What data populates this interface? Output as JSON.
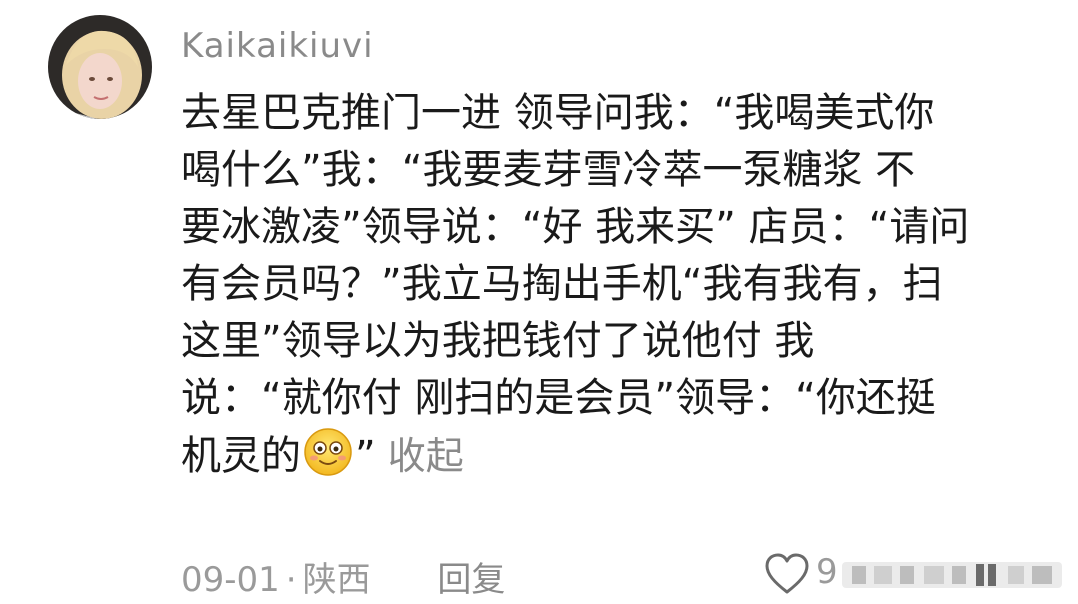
{
  "user": {
    "name": "Kaikaikiuvi"
  },
  "comment": {
    "lines": [
      "去星巴克推门一进 领导问我：“我喝美式你",
      "喝什么”我：“我要麦芽雪冷萃一泵糖浆 不",
      "要冰激凌”领导说：“好 我来买” 店员：“请问",
      "有会员吗？”我立马掏出手机“我有我有，扫",
      "这里”领导以为我把钱付了说他付 我",
      "说：“就你付 刚扫的是会员”领导：“你还挺"
    ],
    "last_line_before_emoji": "机灵的",
    "last_line_after_emoji": "”",
    "emoji_icon": "smiling-face-icon",
    "collapse_label": "收起"
  },
  "footer": {
    "date": "09-01",
    "separator": "·",
    "location": "陕西",
    "reply_label": "回复",
    "like_count": "9",
    "like_icon": "heart-outline-icon"
  },
  "colors": {
    "text_primary": "#1a1a1a",
    "text_secondary": "#8a8a8a",
    "background": "#ffffff"
  }
}
